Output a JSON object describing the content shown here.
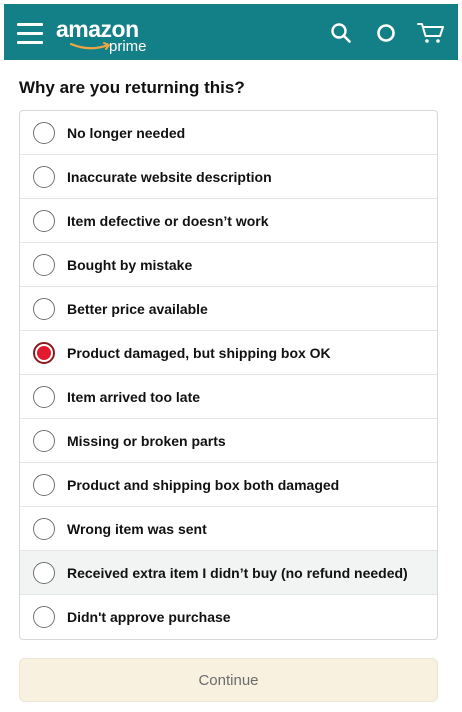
{
  "header": {
    "background": "#137f87",
    "logo_word": "amazon",
    "logo_sub": "prime",
    "icons": [
      "menu-icon",
      "search-icon",
      "circle-icon",
      "cart-icon"
    ]
  },
  "question": "Why are you returning this?",
  "options": [
    {
      "label": "No longer needed",
      "selected": false
    },
    {
      "label": "Inaccurate website description",
      "selected": false
    },
    {
      "label": "Item defective or doesn’t work",
      "selected": false
    },
    {
      "label": "Bought by mistake",
      "selected": false
    },
    {
      "label": "Better price available",
      "selected": false
    },
    {
      "label": "Product damaged, but shipping box OK",
      "selected": true
    },
    {
      "label": "Item arrived too late",
      "selected": false
    },
    {
      "label": "Missing or broken parts",
      "selected": false
    },
    {
      "label": "Product and shipping box both damaged",
      "selected": false
    },
    {
      "label": "Wrong item was sent",
      "selected": false
    },
    {
      "label": "Received extra item I didn’t buy (no refund needed)",
      "selected": false
    },
    {
      "label": "Didn't approve purchase",
      "selected": false
    }
  ],
  "continue_label": "Continue",
  "colors": {
    "selected_radio": "#e3192e",
    "continue_bg": "#f8f1df"
  }
}
